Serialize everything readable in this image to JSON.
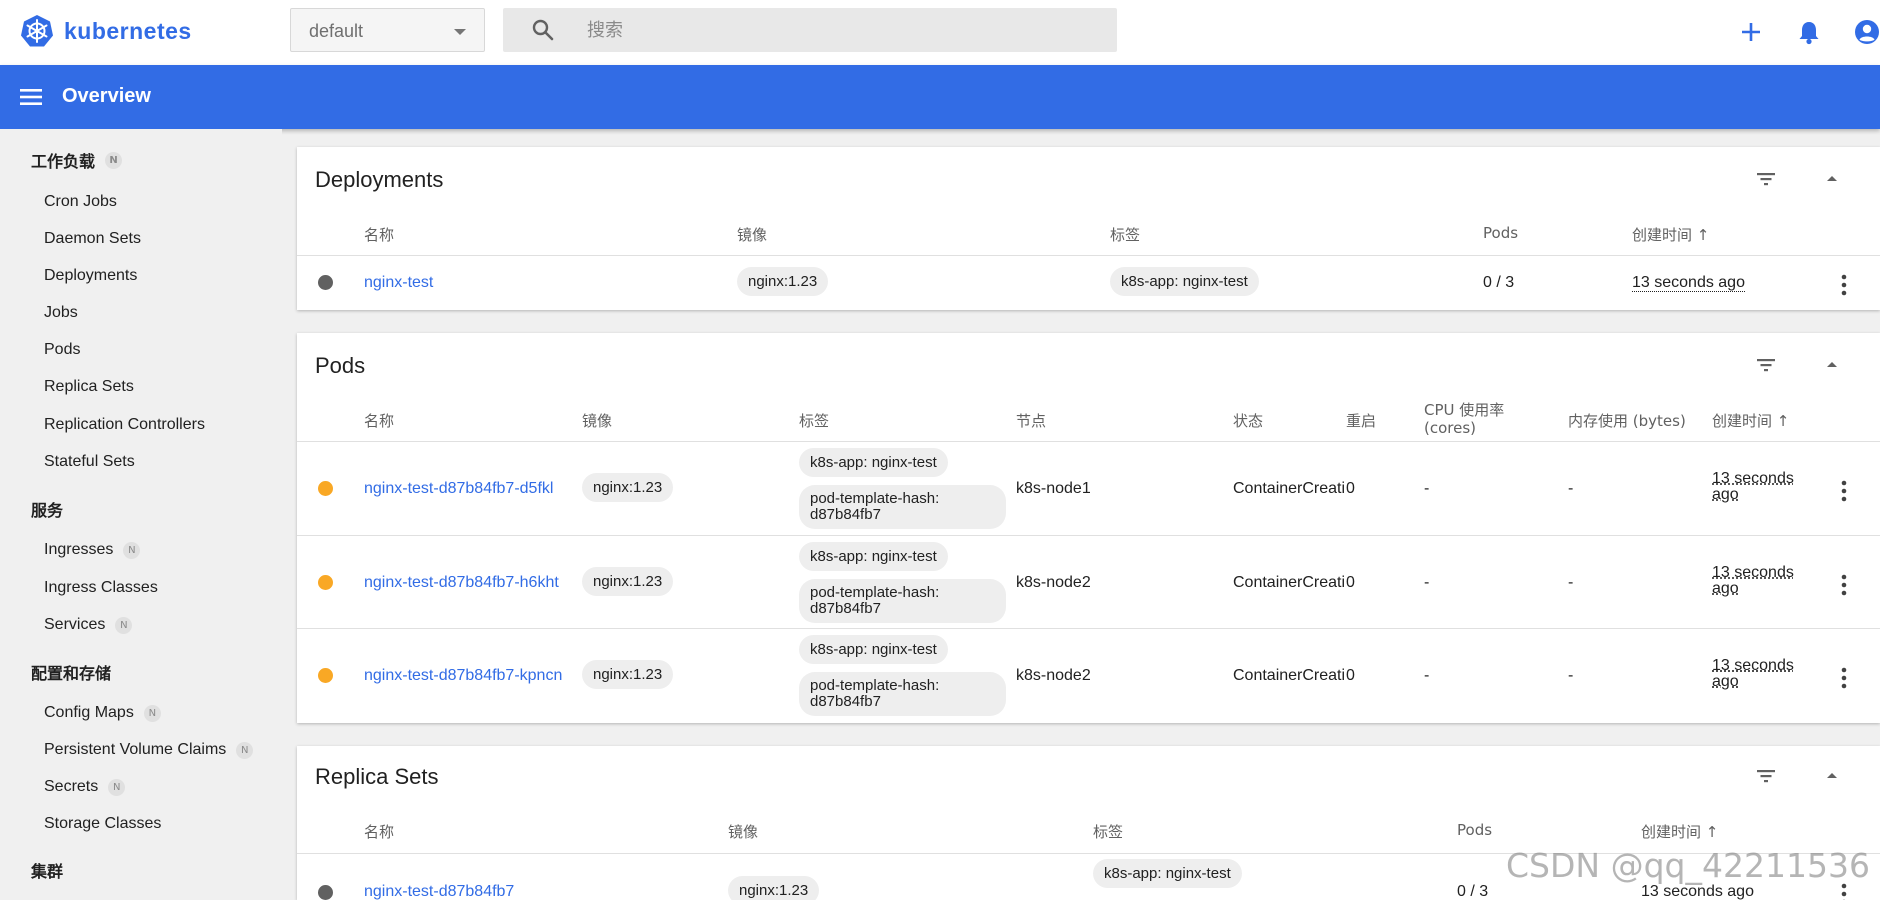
{
  "app": {
    "name": "kubernetes"
  },
  "namespace": {
    "selected": "default"
  },
  "search": {
    "placeholder": "搜索"
  },
  "page": {
    "title": "Overview"
  },
  "colors": {
    "accent": "#326ce5",
    "pending": "#f9a825",
    "unknown": "#616161"
  },
  "sidebar": {
    "sections": [
      {
        "heading": "工作负载",
        "badge": "N",
        "items": [
          {
            "label": "Cron Jobs"
          },
          {
            "label": "Daemon Sets"
          },
          {
            "label": "Deployments"
          },
          {
            "label": "Jobs"
          },
          {
            "label": "Pods"
          },
          {
            "label": "Replica Sets"
          },
          {
            "label": "Replication Controllers"
          },
          {
            "label": "Stateful Sets"
          }
        ]
      },
      {
        "heading": "服务",
        "items": [
          {
            "label": "Ingresses",
            "badge": "N"
          },
          {
            "label": "Ingress Classes"
          },
          {
            "label": "Services",
            "badge": "N"
          }
        ]
      },
      {
        "heading": "配置和存储",
        "items": [
          {
            "label": "Config Maps",
            "badge": "N"
          },
          {
            "label": "Persistent Volume Claims",
            "badge": "N"
          },
          {
            "label": "Secrets",
            "badge": "N"
          },
          {
            "label": "Storage Classes"
          }
        ]
      },
      {
        "heading": "集群"
      }
    ]
  },
  "deployments": {
    "title": "Deployments",
    "columns": {
      "name": "名称",
      "image": "镜像",
      "labels": "标签",
      "pods": "Pods",
      "created": "创建时间"
    },
    "rows": [
      {
        "status": "unknown",
        "name": "nginx-test",
        "image": "nginx:1.23",
        "label": "k8s-app: nginx-test",
        "pods": "0 / 3",
        "created": "13 seconds ago"
      }
    ]
  },
  "pods": {
    "title": "Pods",
    "columns": {
      "name": "名称",
      "image": "镜像",
      "labels": "标签",
      "node": "节点",
      "status": "状态",
      "restarts": "重启",
      "cpu": "CPU 使用率 (cores)",
      "memory": "内存使用 (bytes)",
      "created": "创建时间"
    },
    "rows": [
      {
        "status": "pending",
        "name": "nginx-test-d87b84fb7-d5fkl",
        "image": "nginx:1.23",
        "label1": "k8s-app: nginx-test",
        "label2": "pod-template-hash: d87b84fb7",
        "node": "k8s-node1",
        "state": "ContainerCreati",
        "restarts": "0",
        "cpu": "-",
        "memory": "-",
        "created": "13 seconds ago"
      },
      {
        "status": "pending",
        "name": "nginx-test-d87b84fb7-h6kht",
        "image": "nginx:1.23",
        "label1": "k8s-app: nginx-test",
        "label2": "pod-template-hash: d87b84fb7",
        "node": "k8s-node2",
        "state": "ContainerCreati",
        "restarts": "0",
        "cpu": "-",
        "memory": "-",
        "created": "13 seconds ago"
      },
      {
        "status": "pending",
        "name": "nginx-test-d87b84fb7-kpncn",
        "image": "nginx:1.23",
        "label1": "k8s-app: nginx-test",
        "label2": "pod-template-hash: d87b84fb7",
        "node": "k8s-node2",
        "state": "ContainerCreati",
        "restarts": "0",
        "cpu": "-",
        "memory": "-",
        "created": "13 seconds ago"
      }
    ]
  },
  "replicasets": {
    "title": "Replica Sets",
    "columns": {
      "name": "名称",
      "image": "镜像",
      "labels": "标签",
      "pods": "Pods",
      "created": "创建时间"
    },
    "rows": [
      {
        "status": "unknown",
        "name": "nginx-test-d87b84fb7",
        "image": "nginx:1.23",
        "label": "k8s-app: nginx-test",
        "pods": "0 / 3",
        "created": "13 seconds ago"
      }
    ]
  },
  "watermark": "CSDN @qq_42211536"
}
